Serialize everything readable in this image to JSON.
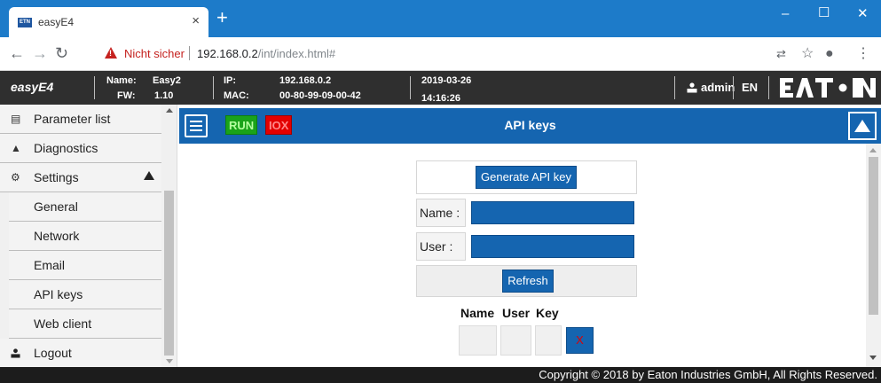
{
  "browser": {
    "tab_title": "easyE4",
    "tab_favicon": "ETN",
    "security_label": "Nicht sicher",
    "url_host": "192.168.0.2",
    "url_path": "/int/index.html#"
  },
  "header": {
    "app_name": "easyE4",
    "name_label": "Name:",
    "name_value": "Easy2",
    "fw_label": "FW:",
    "fw_value": "1.10",
    "ip_label": "IP:",
    "ip_value": "192.168.0.2",
    "mac_label": "MAC:",
    "mac_value": "00-80-99-09-00-42",
    "date": "2019-03-26",
    "time": "14:16:26",
    "user": "admin",
    "language": "EN",
    "brand": "EATON"
  },
  "sidebar": {
    "items": [
      {
        "label": "Parameter list",
        "icon": "list-icon"
      },
      {
        "label": "Diagnostics",
        "icon": "warning-icon"
      },
      {
        "label": "Settings",
        "icon": "gear-icon",
        "expanded": true
      },
      {
        "label": "General",
        "sub": true
      },
      {
        "label": "Network",
        "sub": true
      },
      {
        "label": "Email",
        "sub": true
      },
      {
        "label": "API keys",
        "sub": true
      },
      {
        "label": "Web client",
        "sub": true
      },
      {
        "label": "Logout",
        "icon": "user-icon"
      }
    ]
  },
  "toolbar": {
    "run_badge": "RUN",
    "iox_badge": "IOX",
    "page_title": "API keys",
    "colors": {
      "accent": "#1565b0",
      "run": "#1aa31a",
      "iox": "#e30000"
    }
  },
  "api_keys": {
    "generate_label": "Generate API key",
    "name_label": "Name :",
    "name_value": "",
    "user_label": "User :",
    "user_value": "",
    "refresh_label": "Refresh",
    "columns": [
      "Name",
      "User",
      "Key"
    ],
    "delete_label": "X"
  },
  "footer": {
    "copyright": "Copyright © 2018 by Eaton Industries GmbH, All Rights Reserved."
  }
}
